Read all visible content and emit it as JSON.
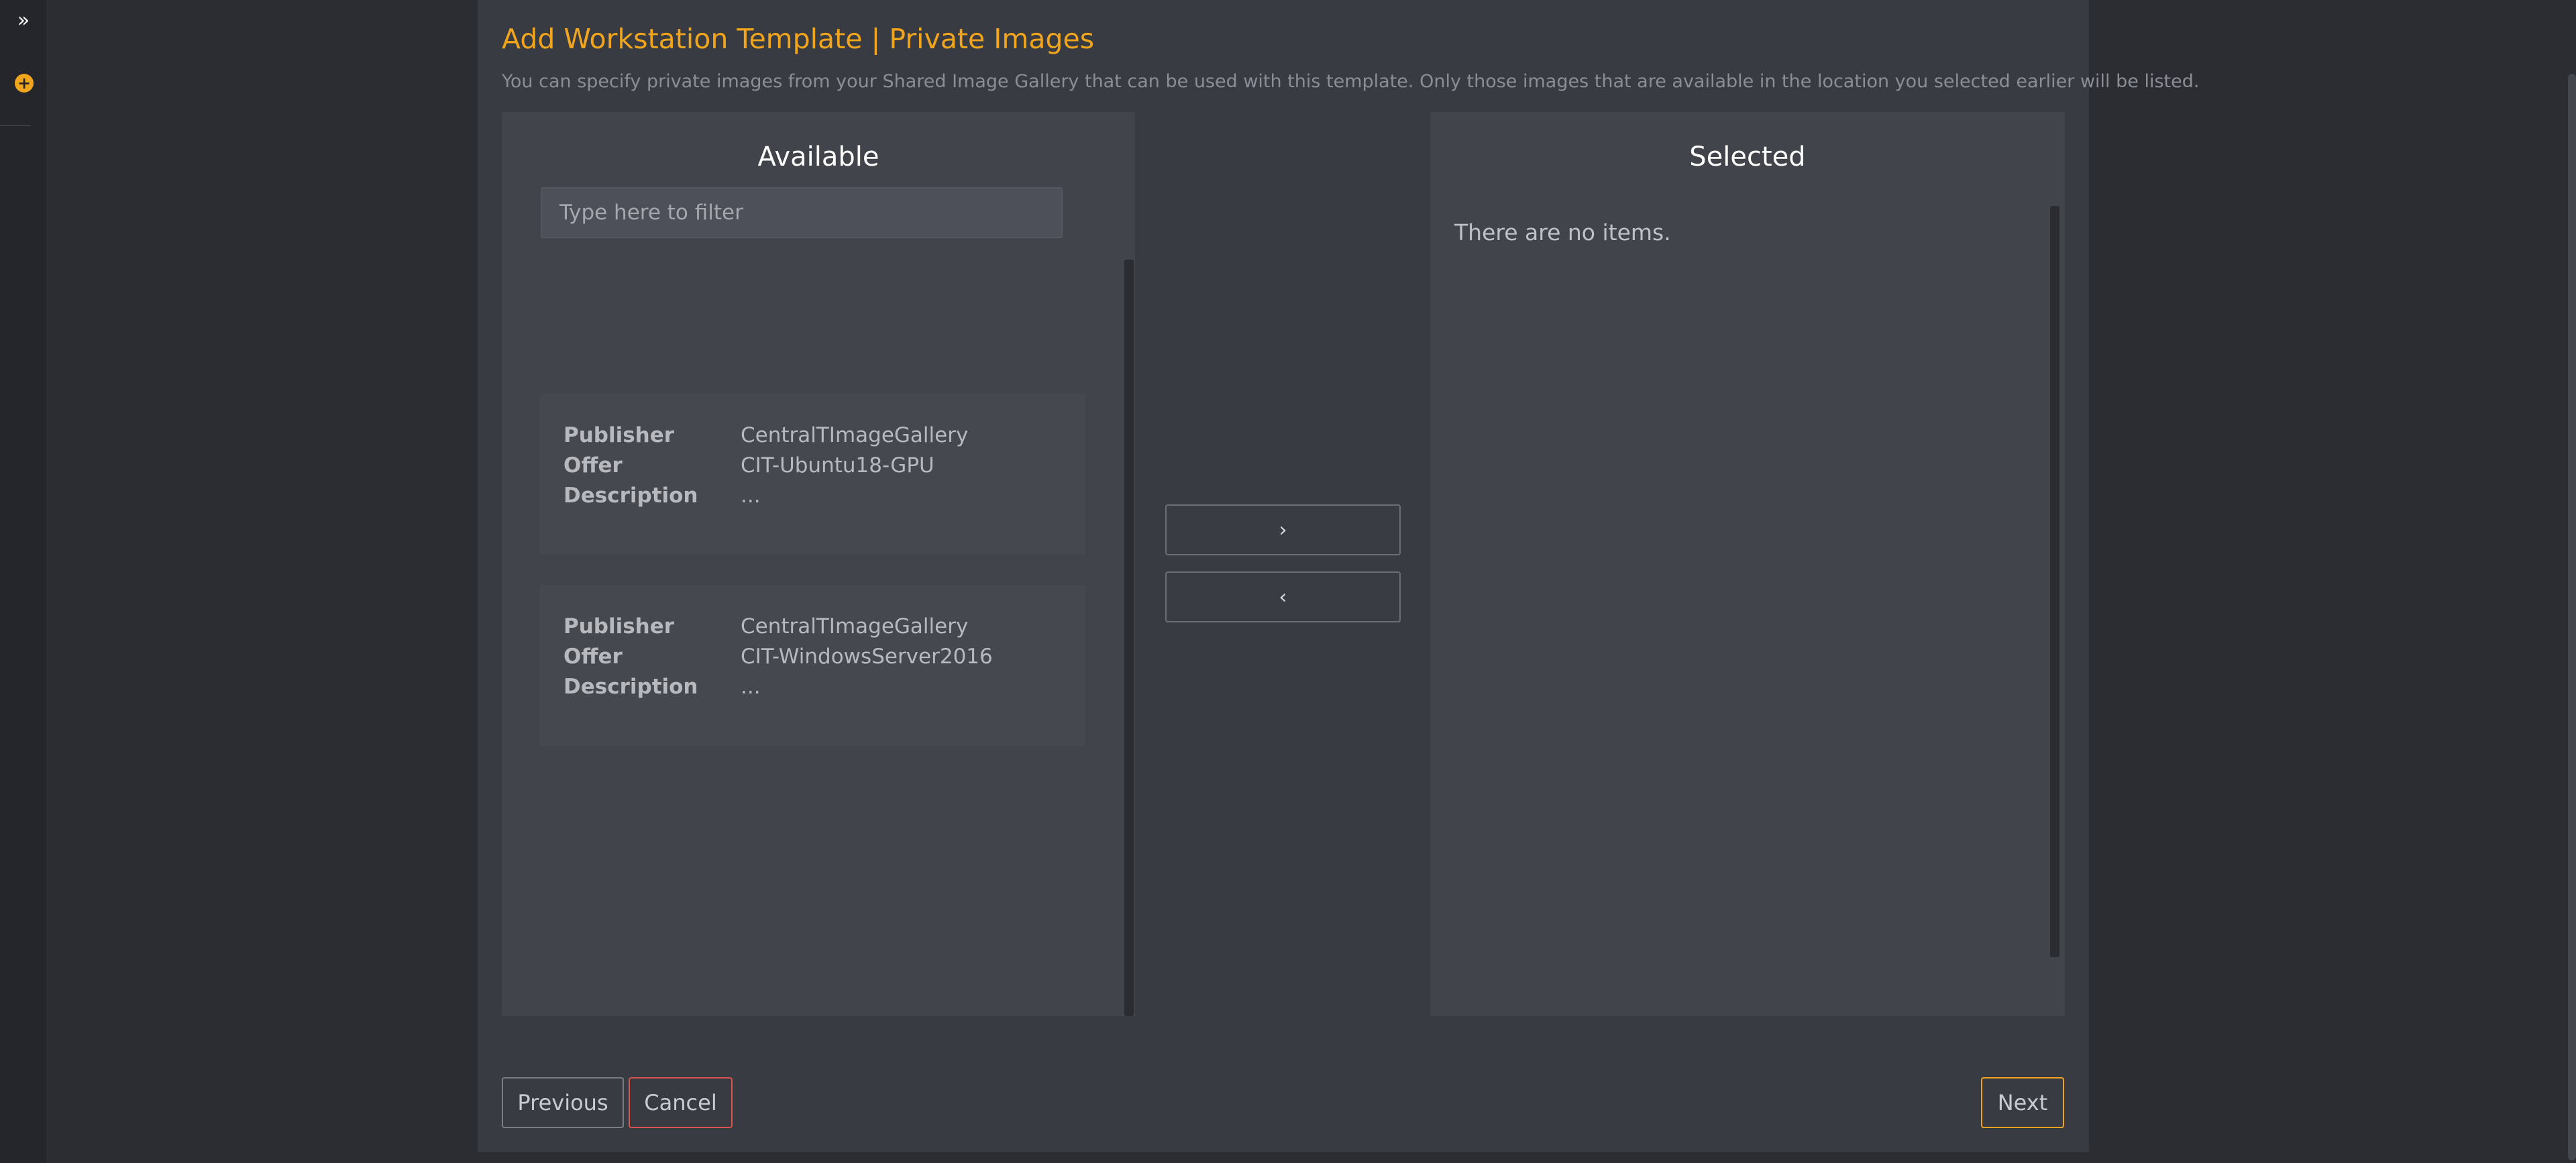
{
  "rail": {
    "expand_icon": "»",
    "add_icon": "+"
  },
  "wizard": {
    "title": "Add Workstation Template | Private Images",
    "subtitle": "You can specify private images from your Shared Image Gallery that can be used with this template. Only those images that are available in the location you selected earlier will be listed."
  },
  "available": {
    "heading": "Available",
    "filter_placeholder": "Type here to filter",
    "filter_value": "",
    "items": [
      {
        "publisher_label": "Publisher",
        "publisher": "CentralTImageGallery",
        "offer_label": "Offer",
        "offer": "CIT-Ubuntu18-GPU",
        "description_label": "Description",
        "description": "..."
      },
      {
        "publisher_label": "Publisher",
        "publisher": "CentralTImageGallery",
        "offer_label": "Offer",
        "offer": "CIT-WindowsServer2016",
        "description_label": "Description",
        "description": "..."
      }
    ]
  },
  "transfer": {
    "add_label": "›",
    "remove_label": "‹"
  },
  "selected": {
    "heading": "Selected",
    "empty_text": "There are no items."
  },
  "footer": {
    "previous_label": "Previous",
    "cancel_label": "Cancel",
    "next_label": "Next"
  },
  "colors": {
    "accent": "#f0a51c",
    "danger": "#d9534f",
    "background": "#2b2d33",
    "panel": "#393b43"
  }
}
